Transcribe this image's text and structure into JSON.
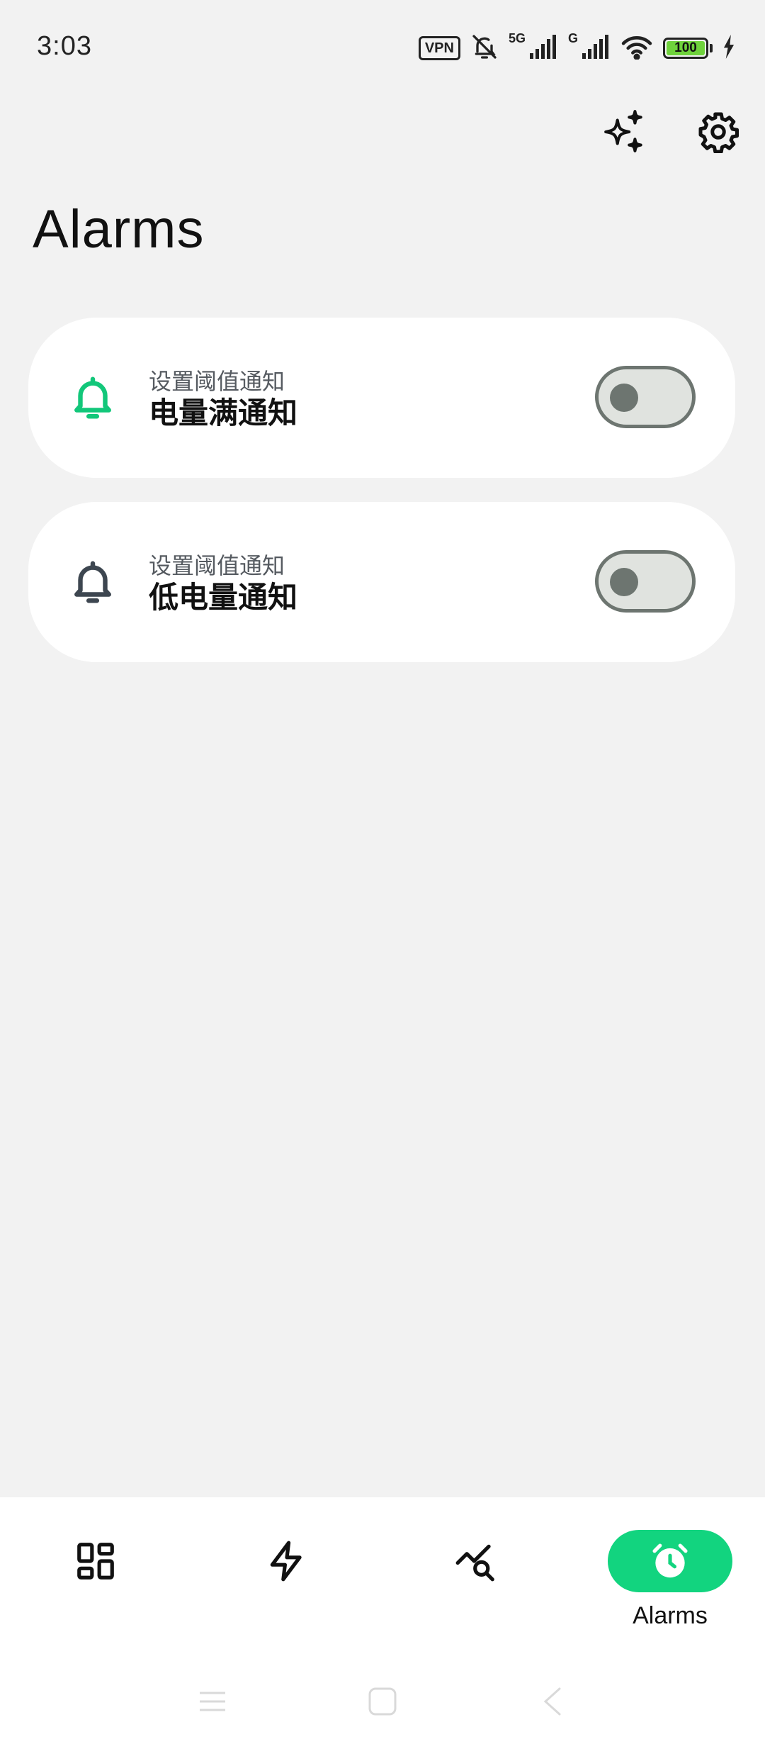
{
  "status_bar": {
    "time": "3:03",
    "vpn": "VPN",
    "net_5g": "5G",
    "net_g": "G",
    "battery": "100",
    "icons": [
      "vpn-icon",
      "bell-off-icon",
      "signal-icon",
      "wifi-icon",
      "battery-icon",
      "charging-bolt-icon"
    ]
  },
  "header": {
    "title": "Alarms",
    "actions": [
      "sparkle-icon",
      "settings-gear-icon"
    ]
  },
  "alarms": [
    {
      "subtitle": "设置阈值通知",
      "title": "电量满通知",
      "icon": "bell-icon",
      "icon_color": "#12c77a",
      "enabled": false
    },
    {
      "subtitle": "设置阈值通知",
      "title": "低电量通知",
      "icon": "bell-icon",
      "icon_color": "#3d4650",
      "enabled": false
    }
  ],
  "bottom_nav": {
    "items": [
      {
        "icon": "dashboard-grid-icon",
        "label": ""
      },
      {
        "icon": "lightning-icon",
        "label": ""
      },
      {
        "icon": "chart-search-icon",
        "label": ""
      },
      {
        "icon": "alarm-clock-icon",
        "label": "Alarms",
        "active": true
      }
    ]
  },
  "colors": {
    "accent": "#12d47f",
    "background": "#f2f2f2",
    "card": "#ffffff",
    "toggle_track": "#e0e3df",
    "toggle_border": "#6d7570"
  }
}
